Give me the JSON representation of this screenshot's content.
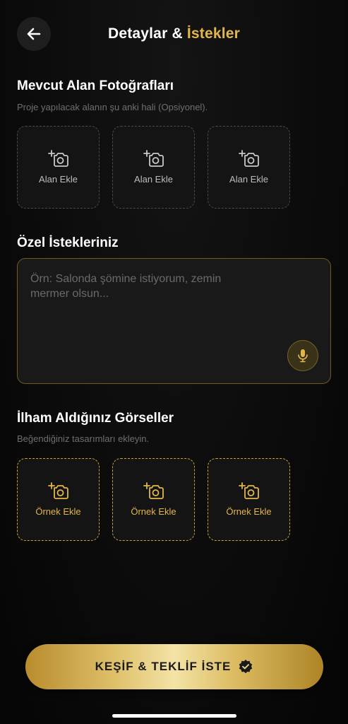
{
  "header": {
    "title_prefix": "Detaylar & ",
    "title_accent": "İstekler"
  },
  "site_photos": {
    "title": "Mevcut Alan Fotoğrafları",
    "subtitle": "Proje yapılacak alanın şu anki hali (Opsiyonel).",
    "tiles": [
      {
        "label": "Alan Ekle",
        "icon": "add-photo-icon"
      },
      {
        "label": "Alan Ekle",
        "icon": "add-photo-icon"
      },
      {
        "label": "Alan Ekle",
        "icon": "add-photo-icon"
      }
    ]
  },
  "requests": {
    "title": "Özel İstekleriniz",
    "placeholder": "Örn: Salonda şömine istiyorum, zemin mermer olsun...",
    "mic_icon": "microphone-icon"
  },
  "inspiration": {
    "title": "İlham Aldığınız Görseller",
    "subtitle": "Beğendiğiniz tasarımları ekleyin.",
    "tiles": [
      {
        "label": "Örnek Ekle",
        "icon": "add-photo-icon"
      },
      {
        "label": "Örnek Ekle",
        "icon": "add-photo-icon"
      },
      {
        "label": "Örnek Ekle",
        "icon": "add-photo-icon"
      }
    ]
  },
  "cta": {
    "label": "KEŞİF & TEKLİF İSTE",
    "icon": "verified-badge-icon"
  },
  "colors": {
    "accent_gold": "#e3b64a",
    "background": "#0b0b0b",
    "tile_border_gray": "#4a4a4a",
    "tile_border_gold": "#caa238"
  }
}
